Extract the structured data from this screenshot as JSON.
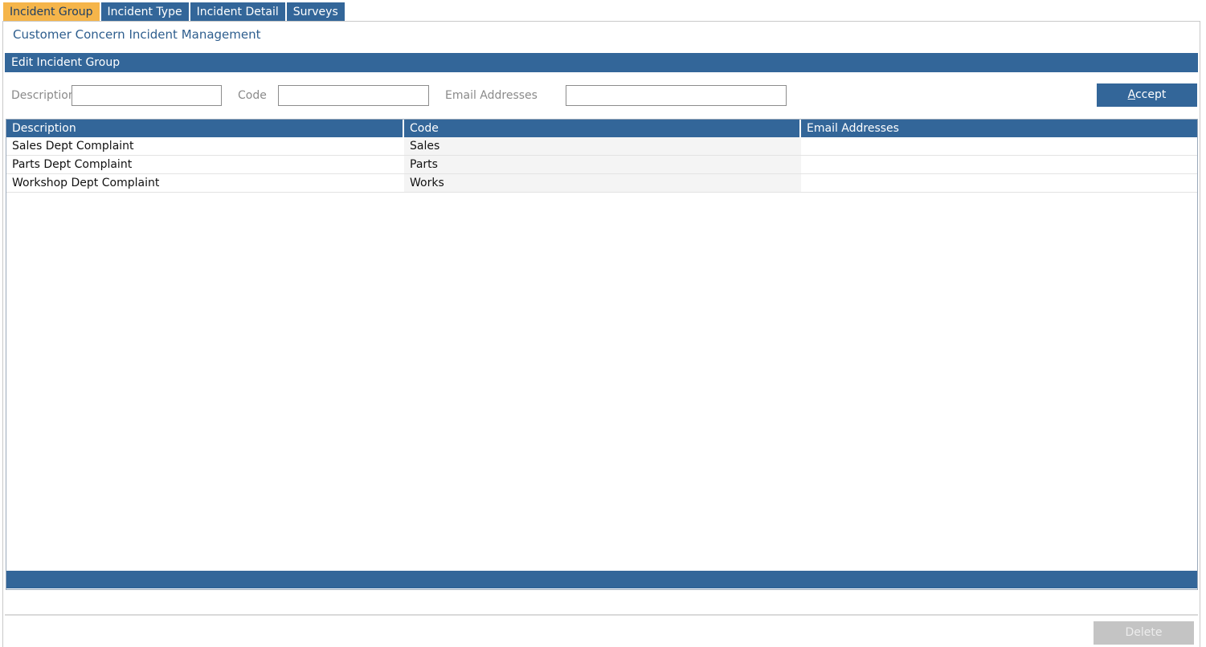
{
  "tabs": [
    {
      "label": "Incident Group",
      "active": true
    },
    {
      "label": "Incident Type",
      "active": false
    },
    {
      "label": "Incident Detail",
      "active": false
    },
    {
      "label": "Surveys",
      "active": false
    }
  ],
  "page_title": "Customer Concern Incident Management",
  "section_title": "Edit Incident Group",
  "form": {
    "description_label": "Description",
    "description_value": "",
    "code_label": "Code",
    "code_value": "",
    "email_label": "Email Addresses",
    "email_value": "",
    "accept_label_underlined": "A",
    "accept_label_rest": "ccept"
  },
  "table": {
    "columns": [
      "Description",
      "Code",
      "Email Addresses"
    ],
    "rows": [
      {
        "description": "Sales Dept Complaint",
        "code": "Sales",
        "email": ""
      },
      {
        "description": "Parts Dept Complaint",
        "code": "Parts",
        "email": ""
      },
      {
        "description": "Workshop Dept Complaint",
        "code": "Works",
        "email": ""
      }
    ]
  },
  "footer": {
    "delete_label": "Delete",
    "delete_enabled": false
  },
  "colors": {
    "primary": "#336699",
    "active_tab": "#f5b54a",
    "disabled": "#c4c4c4"
  }
}
